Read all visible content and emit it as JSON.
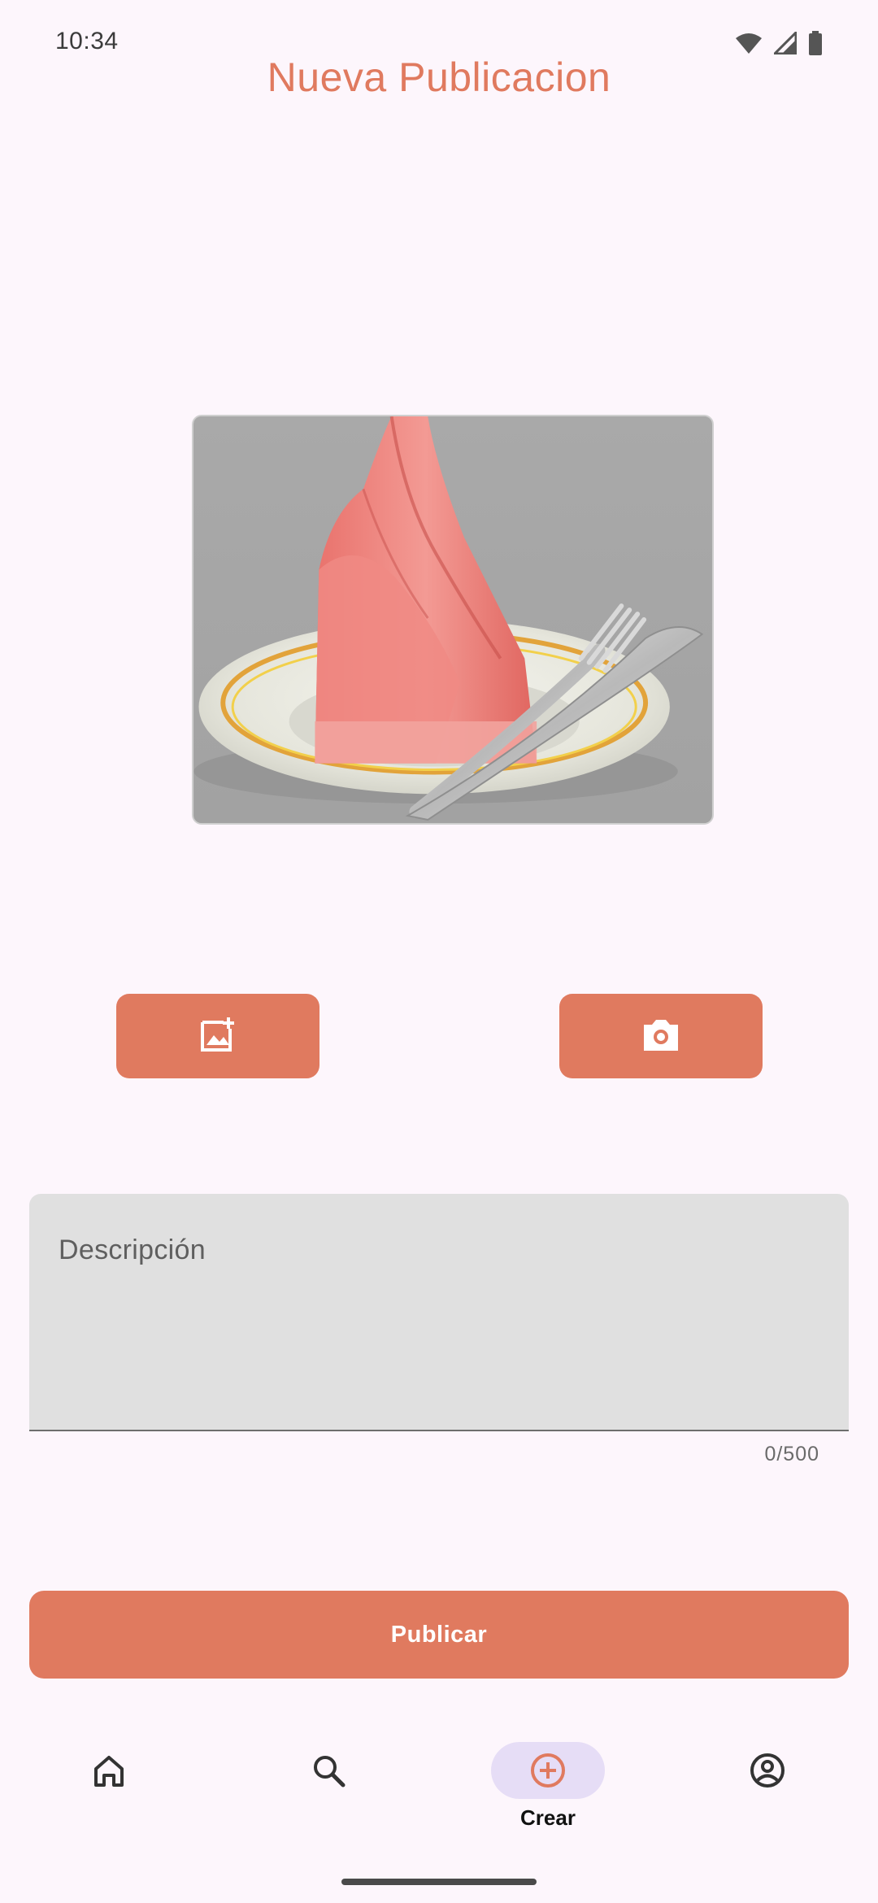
{
  "status_bar": {
    "time": "10:34",
    "icons": [
      "wifi-icon",
      "signal-icon",
      "battery-icon"
    ]
  },
  "header": {
    "title": "Nueva Publicacion"
  },
  "preview": {
    "icon": "napkin-plate-image"
  },
  "actions": {
    "gallery_icon": "add-photo-icon",
    "camera_icon": "camera-icon"
  },
  "description": {
    "placeholder": "Descripción",
    "counter": "0/500"
  },
  "publish": {
    "label": "Publicar"
  },
  "bottom_nav": {
    "items": [
      {
        "icon": "home-icon",
        "label": ""
      },
      {
        "icon": "search-icon",
        "label": ""
      },
      {
        "icon": "add-circle-icon",
        "label": "Crear"
      },
      {
        "icon": "account-icon",
        "label": ""
      }
    ]
  },
  "colors": {
    "accent": "#E07A5F",
    "background": "#FDF6FC",
    "field": "#E0E0E0",
    "nav_active": "#E6DDF6"
  }
}
